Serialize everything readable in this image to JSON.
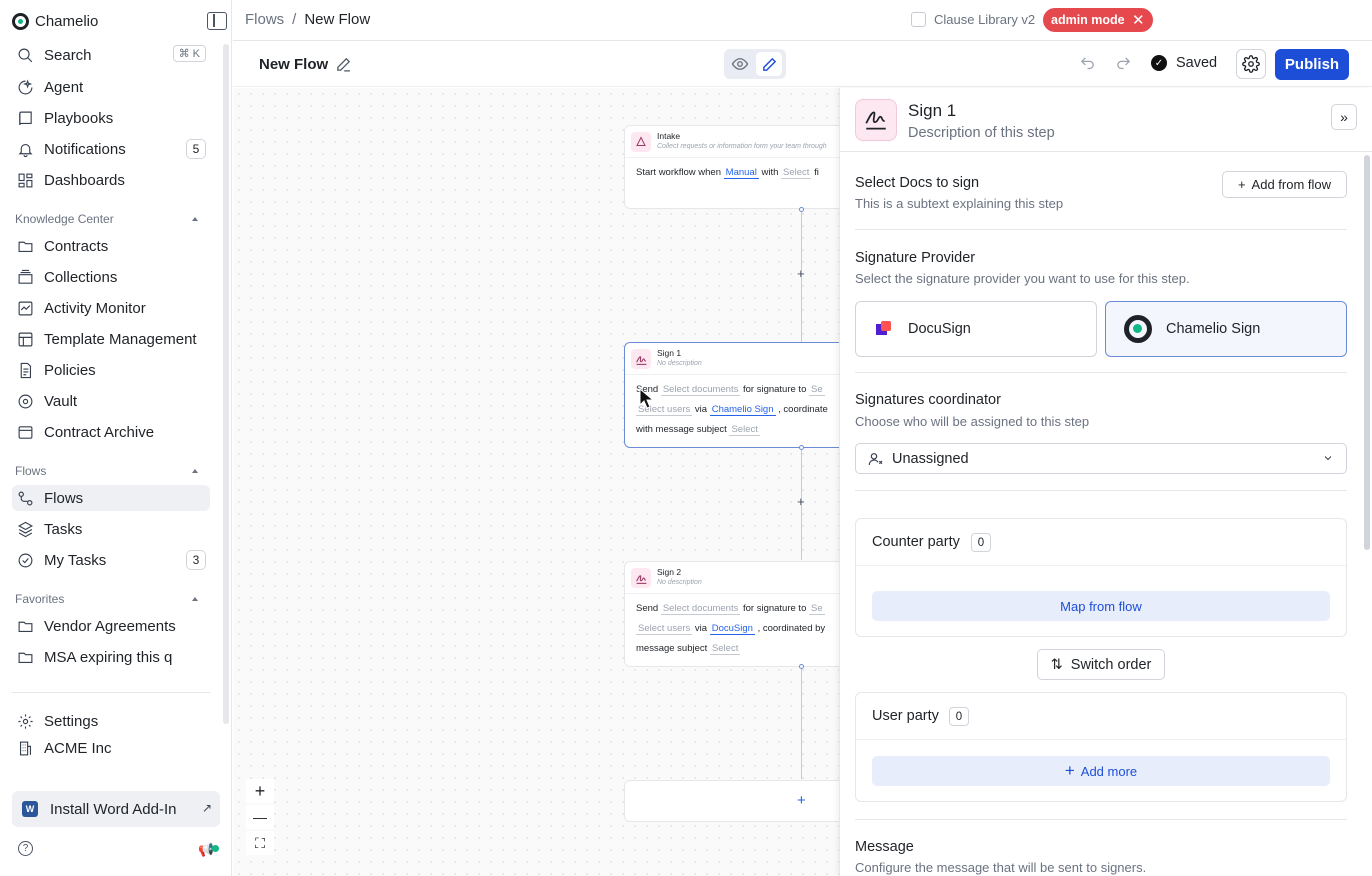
{
  "app": {
    "name": "Chamelio"
  },
  "sidebar": {
    "search_label": "Search",
    "search_shortcut": "⌘ K",
    "primary": [
      {
        "label": "Agent",
        "icon": "agent-icon"
      },
      {
        "label": "Playbooks",
        "icon": "book-icon"
      },
      {
        "label": "Notifications",
        "icon": "bell-icon",
        "badge": "5"
      },
      {
        "label": "Dashboards",
        "icon": "dashboard-icon"
      }
    ],
    "knowledge_label": "Knowledge Center",
    "knowledge": [
      {
        "label": "Contracts",
        "icon": "folder-icon"
      },
      {
        "label": "Collections",
        "icon": "collection-icon"
      },
      {
        "label": "Activity Monitor",
        "icon": "activity-icon"
      },
      {
        "label": "Template Management",
        "icon": "template-icon"
      },
      {
        "label": "Policies",
        "icon": "policy-icon"
      },
      {
        "label": "Vault",
        "icon": "vault-icon"
      },
      {
        "label": "Contract Archive",
        "icon": "archive-icon"
      }
    ],
    "flows_label": "Flows",
    "flows": [
      {
        "label": "Flows",
        "icon": "flows-icon",
        "active": true
      },
      {
        "label": "Tasks",
        "icon": "tasks-icon"
      },
      {
        "label": "My Tasks",
        "icon": "my-tasks-icon",
        "badge": "3"
      }
    ],
    "favorites_label": "Favorites",
    "favorites": [
      {
        "label": "Vendor Agreements",
        "icon": "folder-icon"
      },
      {
        "label": "MSA expiring this q",
        "icon": "folder-icon"
      }
    ],
    "settings_label": "Settings",
    "org_label": "ACME Inc",
    "addin_label": "Install Word Add-In",
    "addin_icon_text": "W"
  },
  "topbar": {
    "breadcrumb_root": "Flows",
    "breadcrumb_sep": "/",
    "breadcrumb_current": "New Flow",
    "clause_library_label": "Clause Library v2",
    "admin_mode_label": "admin mode"
  },
  "flowbar": {
    "title": "New Flow",
    "saved_label": "Saved",
    "publish_label": "Publish"
  },
  "canvas": {
    "intake": {
      "title": "Intake",
      "desc": "Collect requests or information form your team through",
      "line_prefix": "Start workflow when",
      "trigger": "Manual",
      "with": "with",
      "select": "Select",
      "tail": "fi"
    },
    "sign1": {
      "title": "Sign 1",
      "desc": "No description",
      "send": "Send",
      "docs": "Select documents",
      "for_sig": "for signature to",
      "to_select": "Se",
      "users": "Select users",
      "via": "via",
      "provider": "Chamelio Sign",
      "coord": ", coordinate",
      "msg": "with message subject",
      "msg_select": "Select"
    },
    "sign2": {
      "title": "Sign 2",
      "desc": "No description",
      "send": "Send",
      "docs": "Select documents",
      "for_sig": "for signature to",
      "to_select": "Se",
      "users": "Select users",
      "via": "via",
      "provider": "DocuSign",
      "coord": ", coordinated by",
      "msg": "message subject",
      "msg_select": "Select"
    },
    "zoom_in": "+",
    "zoom_out": "—",
    "fit": "⛶",
    "plus": "+"
  },
  "panel": {
    "step_title": "Sign 1",
    "step_desc": "Description of this step",
    "docs_title": "Select Docs to sign",
    "docs_sub": "This is a subtext explaining this step",
    "add_from_flow": "Add from flow",
    "provider_title": "Signature Provider",
    "provider_sub": "Select the signature provider you want to use for this step.",
    "providers": [
      "DocuSign",
      "Chamelio Sign"
    ],
    "selected_provider": "Chamelio Sign",
    "coordinator_title": "Signatures coordinator",
    "coordinator_sub": "Choose who will be assigned to this step",
    "coordinator_value": "Unassigned",
    "counter_party_title": "Counter party",
    "counter_party_count": "0",
    "map_from_flow": "Map from flow",
    "switch_order": "Switch order",
    "user_party_title": "User party",
    "user_party_count": "0",
    "add_more": "Add more",
    "message_title": "Message",
    "message_sub": "Configure the message that will be sent to signers."
  },
  "colors": {
    "accent": "#1d4ed8",
    "admin": "#e5484d",
    "brand_dot": "#10b981"
  }
}
